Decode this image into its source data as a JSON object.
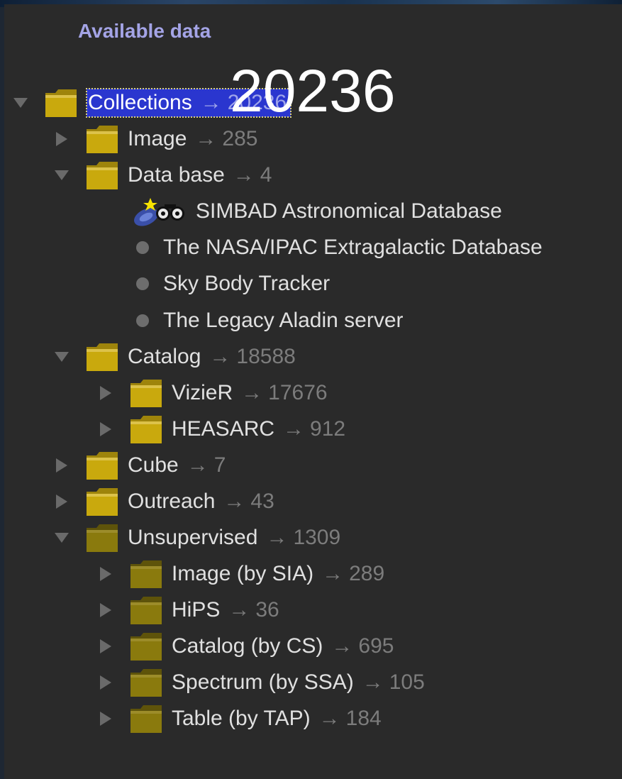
{
  "panel": {
    "title": "Available data"
  },
  "overlay": {
    "count": "20236"
  },
  "tree": {
    "root": {
      "label": "Collections",
      "arrow": "→",
      "count": "20236"
    },
    "image": {
      "label": "Image",
      "arrow": "→",
      "count": "285"
    },
    "database": {
      "label": "Data base",
      "arrow": "→",
      "count": "4"
    },
    "db_items": [
      {
        "label": "SIMBAD Astronomical Database"
      },
      {
        "label": "The NASA/IPAC Extragalactic Database"
      },
      {
        "label": "Sky Body Tracker"
      },
      {
        "label": "The Legacy Aladin server"
      }
    ],
    "catalog": {
      "label": "Catalog",
      "arrow": "→",
      "count": "18588"
    },
    "vizier": {
      "label": "VizieR",
      "arrow": "→",
      "count": "17676"
    },
    "heasarc": {
      "label": "HEASARC",
      "arrow": "→",
      "count": "912"
    },
    "cube": {
      "label": "Cube",
      "arrow": "→",
      "count": "7"
    },
    "outreach": {
      "label": "Outreach",
      "arrow": "→",
      "count": "43"
    },
    "unsupervised": {
      "label": "Unsupervised",
      "arrow": "→",
      "count": "1309"
    },
    "sia": {
      "label": "Image (by SIA)",
      "arrow": "→",
      "count": "289"
    },
    "hips": {
      "label": "HiPS",
      "arrow": "→",
      "count": "36"
    },
    "cs": {
      "label": "Catalog (by CS)",
      "arrow": "→",
      "count": "695"
    },
    "ssa": {
      "label": "Spectrum (by SSA)",
      "arrow": "→",
      "count": "105"
    },
    "tap": {
      "label": "Table (by TAP)",
      "arrow": "→",
      "count": "184"
    }
  },
  "colors": {
    "background": "#2a2a2a",
    "title": "#a4a4e6",
    "selection": "#2a36cf",
    "folder": "#c9a90d",
    "folder_dark": "#8a7a0d"
  },
  "icons": {
    "expand": "triangle-down",
    "collapse": "triangle-right",
    "folder": "folder-icon",
    "simbad": "simbad-logo-icon"
  }
}
